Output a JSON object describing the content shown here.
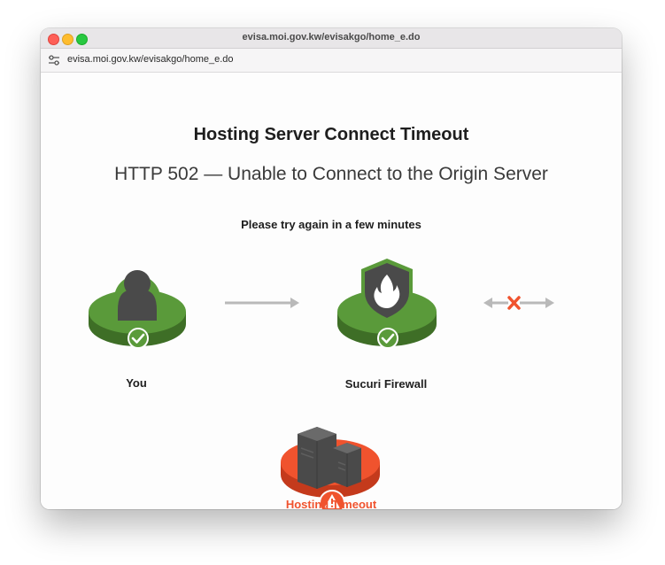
{
  "window": {
    "title": "evisa.moi.gov.kw/evisakgo/home_e.do"
  },
  "address_bar": {
    "url": "evisa.moi.gov.kw/evisakgo/home_e.do",
    "icon": "site-settings-icon"
  },
  "page": {
    "heading": "Hosting Server Connect Timeout",
    "subheading": "HTTP 502 — Unable to Connect to the Origin Server",
    "message": "Please try again in a few minutes"
  },
  "diagram": {
    "nodes": [
      {
        "label": "You",
        "status": "ok",
        "icon": "user-icon",
        "color": "#5a9a3a"
      },
      {
        "label": "Sucuri Firewall",
        "status": "ok",
        "icon": "firewall-shield-icon",
        "color": "#5a9a3a"
      },
      {
        "label": "Hosting Timeout",
        "status": "error",
        "icon": "server-icon",
        "color": "#f0532e"
      }
    ],
    "links": [
      {
        "from": "You",
        "to": "Sucuri Firewall",
        "state": "connected"
      },
      {
        "from": "Sucuri Firewall",
        "to": "Hosting Timeout",
        "state": "failed"
      }
    ]
  },
  "colors": {
    "ok_green": "#5a9a3a",
    "error_orange": "#f0532e",
    "arrow_grey": "#b9b9b9"
  }
}
